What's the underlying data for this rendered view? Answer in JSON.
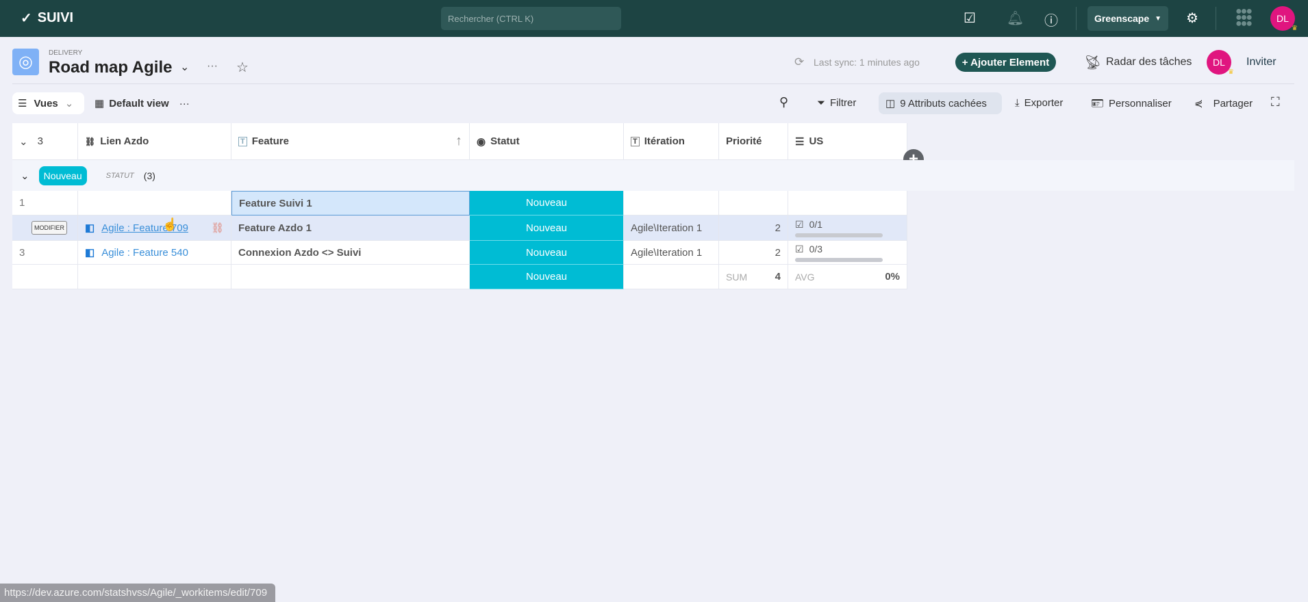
{
  "app": {
    "name": "SUIVI",
    "search_placeholder": "Rechercher (CTRL K)",
    "org": "Greenscape",
    "user_initials": "DL"
  },
  "header": {
    "section": "DELIVERY",
    "title": "Road map Agile",
    "sync": "Last sync: 1 minutes ago",
    "add_button": "+ Ajouter Element",
    "radar": "Radar des tâches",
    "invite": "Inviter"
  },
  "toolbar": {
    "views": "Vues",
    "view_name": "Default view",
    "filter": "Filtrer",
    "hidden": "9 Attributs cachées",
    "export": "Exporter",
    "customize": "Personnaliser",
    "share": "Partager"
  },
  "table": {
    "row_count": "3",
    "columns": [
      "Lien Azdo",
      "Feature",
      "Statut",
      "Itération",
      "Priorité",
      "US"
    ],
    "group": {
      "label": "Nouveau",
      "field": "STATUT",
      "count": "(3)"
    },
    "rows": [
      {
        "num": "1",
        "link": "",
        "feature": "Feature Suivi 1",
        "statut": "Nouveau",
        "iteration": "",
        "priorite": "",
        "us": ""
      },
      {
        "num": "",
        "modify": "MODIFIER",
        "link": "Agile : Feature 709",
        "feature": "Feature Azdo 1",
        "statut": "Nouveau",
        "iteration": "Agile\\Iteration 1",
        "priorite": "2",
        "us": "0/1",
        "us_progress": 0
      },
      {
        "num": "3",
        "link": "Agile : Feature 540",
        "feature": "Connexion Azdo <> Suivi",
        "statut": "Nouveau",
        "iteration": "Agile\\Iteration 1",
        "priorite": "2",
        "us": "0/3",
        "us_progress": 0
      }
    ],
    "footer": {
      "statut": "Nouveau",
      "sum_label": "SUM",
      "sum": "4",
      "avg_label": "AVG",
      "avg": "0%"
    }
  },
  "status_url": "https://dev.azure.com/statshvss/Agile/_workitems/edit/709"
}
